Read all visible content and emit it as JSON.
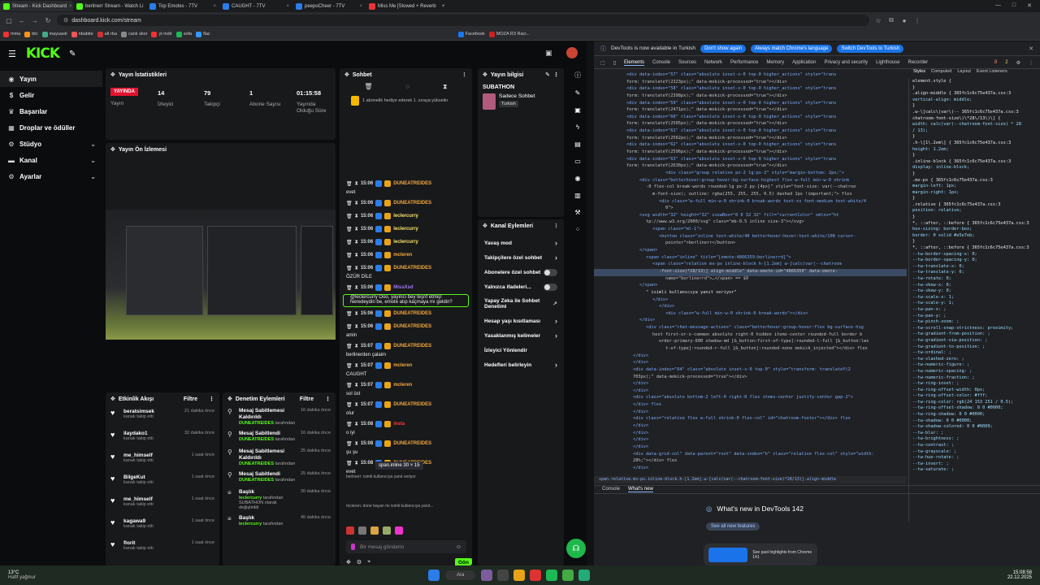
{
  "browser": {
    "tabs": [
      {
        "label": "Stream - Kick Dashboard",
        "color": "#53fc18"
      },
      {
        "label": "berlinerr Stream - Watch Li",
        "color": "#53fc18"
      },
      {
        "label": "Top Emotes - 7TV",
        "color": "#2b7de9"
      },
      {
        "label": "CAUGHT - 7TV",
        "color": "#2b7de9"
      },
      {
        "label": "peepoCheer - 7TV",
        "color": "#2b7de9"
      },
      {
        "label": "Miss Me [Slowed + Reverb",
        "color": "#e33"
      }
    ],
    "url": "dashboard.kick.com/stream",
    "bookmarks": [
      "mma",
      "btc",
      "mayuasti",
      "nbabite",
      "alt rba",
      "canlı skor",
      "yt indir",
      "sofa",
      "flac",
      "Facebook",
      "MOZA R3 Raci..."
    ]
  },
  "kick": {
    "logo": "KICK",
    "nav": [
      {
        "label": "Yayın",
        "icon": "broadcast-icon",
        "chev": false
      },
      {
        "label": "Gelir",
        "icon": "money-icon",
        "chev": false
      },
      {
        "label": "Başarılar",
        "icon": "trophy-icon",
        "chev": false
      },
      {
        "label": "Droplar ve ödüller",
        "icon": "gift-icon",
        "chev": false
      },
      {
        "label": "Stüdyo",
        "icon": "studio-icon",
        "chev": true
      },
      {
        "label": "Kanal",
        "icon": "user-icon",
        "chev": true
      },
      {
        "label": "Ayarlar",
        "icon": "settings-icon",
        "chev": true
      }
    ],
    "stats": {
      "title": "Yayın İstatistikleri",
      "live": "YAYINDA",
      "live_label": "Yayın",
      "viewers": "14",
      "viewers_label": "İzleyici",
      "followers": "79",
      "followers_label": "Takipçi",
      "subs": "1",
      "subs_label": "Abone Sayısı",
      "uptime": "01:15:58",
      "uptime_label": "Yayında Olduğu Süre"
    },
    "preview_title": "Yayın Ön İzlemesi",
    "activity": {
      "title": "Etkinlik Akışı",
      "filter": "Filtre",
      "items": [
        {
          "name": "beratsimsek",
          "sub": "kanalı takip etti",
          "time": "21 dakika önce"
        },
        {
          "name": "ilaydako1",
          "sub": "kanalı takip etti",
          "time": "32 dakika önce"
        },
        {
          "name": "me_himself",
          "sub": "kanalı takip etti",
          "time": "1 saat önce"
        },
        {
          "name": "BilgeKut",
          "sub": "kanalı takip etti",
          "time": "1 saat önce"
        },
        {
          "name": "me_himself",
          "sub": "kanalı takip etti",
          "time": "1 saat önce"
        },
        {
          "name": "kagawa9",
          "sub": "kanalı takip etti",
          "time": "1 saat önce"
        },
        {
          "name": "florit",
          "sub": "kanalı takip etti",
          "time": "1 saat önce"
        }
      ]
    },
    "moderation": {
      "title": "Denetim Eylemleri",
      "filter": "Filtre",
      "items": [
        {
          "title": "Mesaj Sabitlemesi Kaldırıldı",
          "by": "DUNEATREIDES",
          "suffix": "tarafından",
          "time": "16 dakika önce"
        },
        {
          "title": "Mesaj Sabitlendi",
          "by": "DUNEATREIDES",
          "suffix": "tarafından",
          "time": "16 dakika önce"
        },
        {
          "title": "Mesaj Sabitlemesi Kaldırıldı",
          "by": "DUNEATREIDES",
          "suffix": "tarafından",
          "time": "25 dakika önce"
        },
        {
          "title": "Mesaj Sabitlendi",
          "by": "DUNEATREIDES",
          "suffix": "tarafından",
          "time": "25 dakika önce"
        },
        {
          "title": "Başlık",
          "by": "leclercurry",
          "suffix": "tarafından SUBATHON olarak değiştirildi",
          "time": "30 dakika önce"
        },
        {
          "title": "Başlık",
          "by": "leclercurry",
          "suffix": "tarafından",
          "time": "45 dakika önce"
        }
      ]
    },
    "chat": {
      "title": "Sohbet",
      "gift_text": "1 abonelik hediye ederek 1. sıraya yükselin",
      "messages": [
        {
          "time": "15:06",
          "user": "DUNEATREIDES",
          "cls": "u1",
          "text": "evet"
        },
        {
          "time": "15:06",
          "user": "DUNEATREIDES",
          "cls": "u1",
          "text": ""
        },
        {
          "time": "15:06",
          "user": "leclercurry",
          "cls": "u4",
          "text": ""
        },
        {
          "time": "15:06",
          "user": "leclercurry",
          "cls": "u4",
          "text": ""
        },
        {
          "time": "15:06",
          "user": "leclercurry",
          "cls": "u4",
          "text": ""
        },
        {
          "time": "15:06",
          "user": "mcleren",
          "cls": "u1",
          "text": ""
        },
        {
          "time": "15:06",
          "user": "DUNEATREIDES",
          "cls": "u1",
          "text": "ÖZÜR DİLE"
        },
        {
          "time": "15:06",
          "user": "MissXsd",
          "cls": "u5",
          "text": "@leclercurry Ooo, yayıncı bey teşrif etmiş! Neredeydin be, emote atıp kaçmaya mı geldin?"
        },
        {
          "time": "15:06",
          "user": "DUNEATREIDES",
          "cls": "u1",
          "text": ""
        },
        {
          "time": "15:06",
          "user": "DUNEATREIDES",
          "cls": "u1",
          "text": "amin"
        },
        {
          "time": "15:07",
          "user": "DUNEATREIDES",
          "cls": "u1",
          "text": "berlinerden çalaim"
        },
        {
          "time": "15:07",
          "user": "mcleren",
          "cls": "u1",
          "text": "CAUGHT"
        },
        {
          "time": "15:07",
          "user": "mcleren",
          "cls": "u1",
          "text": "sol üst"
        },
        {
          "time": "15:07",
          "user": "DUNEATREIDES",
          "cls": "u1",
          "text": "olur"
        },
        {
          "time": "15:08",
          "user": "insta",
          "cls": "u3",
          "text": "o iyi"
        },
        {
          "time": "15:08",
          "user": "DUNEATREIDES",
          "cls": "u1",
          "text": "şu şu"
        },
        {
          "time": "15:08",
          "user": "DUNEATREIDES",
          "cls": "u1",
          "text": "evet"
        }
      ],
      "tooltip": "span.inline 30 × 15",
      "reply1": "berlinerr: isimli kullanıcıya yanıt veriyor",
      "reply2": "mcleren: done bayan mı isimli kullanıcıya yanıt...",
      "placeholder": "Bir mesaj gönderin",
      "send": "Gön"
    },
    "info": {
      "title": "Yayın bilgisi",
      "stream_title": "SUBATHON",
      "mode": "Sadece Sohbet",
      "lang": "Turkish"
    },
    "actions": {
      "title": "Kanal Eylemleri",
      "items": [
        {
          "label": "Yavaş mod",
          "kind": "chev"
        },
        {
          "label": "Takipçilere özel sohbet",
          "kind": "chev"
        },
        {
          "label": "Abonelere özel sohbet",
          "kind": "toggle"
        },
        {
          "label": "Yalnızca ifadeleri...",
          "kind": "toggle"
        },
        {
          "label": "Yapay Zeka ile Sohbet Denetimi",
          "kind": "ext"
        },
        {
          "label": "Hesap yaşı kısıtlaması",
          "kind": "chev"
        },
        {
          "label": "Yasaklanmış kelimeler",
          "kind": "chev"
        },
        {
          "label": "İzleyici Yönlendir",
          "kind": "none"
        },
        {
          "label": "Hedefleri belirleyin",
          "kind": "chev"
        }
      ]
    }
  },
  "devtools": {
    "notice": "DevTools is now available in Turkish",
    "btn1": "Don't show again",
    "btn2": "Always match Chrome's language",
    "btn3": "Switch DevTools to Turkish",
    "tabs": [
      "Elements",
      "Console",
      "Sources",
      "Network",
      "Performance",
      "Memory",
      "Application",
      "Privacy and security",
      "Lighthouse",
      "Recorder"
    ],
    "side_tabs": [
      "Styles",
      "Computed",
      "Layout",
      "Event Listeners"
    ],
    "errors": "8",
    "warnings": "2",
    "breadcrumb": "span.relative.mx-px.inline-block.h-[1.2em].w-[calc(var(--chatroom-font-size)*28/13)].align-middle",
    "drawer_tabs": [
      "Console",
      "What's new"
    ],
    "whats_new": "What's new in DevTools 142",
    "see_all": "See all new features",
    "highlights": "See past highlights from Chrome 141",
    "lines": [
      "<div data-index=\"57\" class=\"absolute inset-x-0 top-0 higher_actions\" style=\"trans",
      "form: translateY(2323px);\" data-mokick-processed=\"true\"></div>",
      "<div data-index=\"58\" class=\"absolute inset-x-0 top-0 higher_actions\" style=\"trans",
      "form: translateY(2398px);\" data-mokick-processed=\"true\"></div>",
      "<div data-index=\"59\" class=\"absolute inset-x-0 top-0 higher_actions\" style=\"trans",
      "form: translateY(2471px);\" data-mokick-processed=\"true\"></div>",
      "<div data-index=\"60\" class=\"absolute inset-x-0 top-0 higher_actions\" style=\"trans",
      "form: translateY(2505px);\" data-mokick-processed=\"true\"></div>",
      "<div data-index=\"61\" class=\"absolute inset-x-0 top-0 higher_actions\" style=\"trans",
      "form: translateY(2562px);\" data-mokick-processed=\"true\"></div>",
      "<div data-index=\"62\" class=\"absolute inset-x-0 top-0 higher_actions\" style=\"trans",
      "form: translateY(2596px);\" data-mokick-processed=\"true\"></div>",
      "<div data-index=\"63\" class=\"absolute inset-x-0 top-0 higher_actions\" style=\"trans",
      "form: translateY(2630px);\" data-mokick-processed=\"true\"></div>",
      "<div class=\"group relative px-2 lg:px-3\" style=\"margin-bottom: 2px;\">",
      "<div class=\"betterhover:group-hover:bg-surface-highest flex w-full min-w-0 shrink",
      "-0 flex-col break-words rounded-lg px-2 py-[4px]\" style=\"font-size: var(--chatroo",
      "m-font-size); outline: rgba(255, 255, 255, 0.5) dashed 1px !important;\"> flex",
      "<div class=\"w-full min-w-0 shrink-0 break-words text-xs font-medium text-white/4",
      "0\">",
      "<svg width=\"32\" height=\"32\" viewBox=\"0 0 32 32\" fill=\"currentColor\" xmlns=\"ht",
      "tp://www.w3.org/2000/svg\" class=\"mb-0.5 inline size-3\"></svg>",
      "<span class=\"ml-1\">",
      "<button class=\"inline text-white/40 betterhover:hover:text-white/100 cursor-",
      "pointer\">berlinerr</button>",
      "</span>",
      "<span class=\"inline\" title=\"[emote:4866359:berlinerrd]\">",
      "<span class=\"relative mx-px inline-block h-[1.2em] w-[calc(var(--chatroom",
      "-font-size)*28/13)] align-middle\" data-emote-id=\"4866359\" data-emote-",
      "name=\"berlinerrd\">…</span> == $0",
      "</span>",
      "\" isimli kullanıcıya yanıt veriyor\"",
      "</div>",
      "</div>",
      "<div class=\"w-full min-w-0 shrink-0 break-words\"></div>",
      "</div>",
      "<div class=\"chat-message-actions\" class=\"betterhover:group-hover:flex bg-surface-hig",
      "hest first-or-x-common absolute right-0 hidden items-center rounded-full border b",
      "order-primary-600 shadow-md [&_button:first-of-type]:rounded-l-full [&_button:las",
      "t-of-type]:rounded-r-full [&_button]:rounded-none mokick_injected\"></div> flex",
      "</div>",
      "</div>",
      "<div data-index=\"64\" class=\"absolute inset-x-0 top-0\" style=\"transform: translateY(2",
      "703px);\" data-mokick-processed=\"true\"></div>",
      "</div>",
      "</div>",
      "<div class=\"absolute bottom-2 left-0 right-0 flex items-center justify-center gap-2\">",
      "</div>  flex",
      "</div>",
      "<div class=\"relative flex w-full shrink-0 flex-col\" id=\"chatroom-footer\"></div> flex",
      "</div>",
      "</div>",
      "</div>",
      "</div>",
      "<div data-grid-col\" data-parent=\"root\" data-index=\"h\" class=\"relative flex-col\" style=\"width:",
      "28%;\"></div>  flex",
      "</div>"
    ],
    "styles": [
      "element.style {",
      "}",
      ".align-middle {        365fc1c6c75e437a.css:3",
      "  vertical-align: middle;",
      "}",
      ".w-\\[calc\\(var\\(--  365fc1c6c75e437a.css:3",
      "chatroom-font-size\\)\\*28\\/13\\)\\] {",
      "  width: calc(var(--chatroom-font-size) * 28",
      "  / 13);",
      "}",
      ".h-\\[1\\.2em\\] {       365fc1c6c75e437a.css:3",
      "  height: 1.2em;",
      "}",
      ".inline-block {        365fc1c6c75e437a.css:3",
      "  display: inline-block;",
      "}",
      ".mx-px {               365fc1c6c75e437a.css:3",
      "  margin-left: 1px;",
      "  margin-right: 1px;",
      "}",
      ".relative {            365fc1c6c75e437a.css:3",
      "  position: relative;",
      "}",
      "*, ::after, ::before { 365fc1c6c75e437a.css:3",
      "  box-sizing: border-box;",
      "  border: 0 solid #e5e7eb;",
      "}",
      "*, ::after, ::before { 365fc1c6c75e437a.css:3",
      "  --tw-border-spacing-x: 0;",
      "  --tw-border-spacing-y: 0;",
      "  --tw-translate-x: 0;",
      "  --tw-translate-y: 0;",
      "  --tw-rotate: 0;",
      "  --tw-skew-x: 0;",
      "  --tw-skew-y: 0;",
      "  --tw-scale-x: 1;",
      "  --tw-scale-y: 1;",
      "  --tw-pan-x: ;",
      "  --tw-pan-y: ;",
      "  --tw-pinch-zoom: ;",
      "  --tw-scroll-snap-strictness: proximity;",
      "  --tw-gradient-from-position: ;",
      "  --tw-gradient-via-position: ;",
      "  --tw-gradient-to-position: ;",
      "  --tw-ordinal: ;",
      "  --tw-slashed-zero: ;",
      "  --tw-numeric-figure: ;",
      "  --tw-numeric-spacing: ;",
      "  --tw-numeric-fraction: ;",
      "  --tw-ring-inset: ;",
      "  --tw-ring-offset-width: 0px;",
      "  --tw-ring-offset-color: #fff;",
      "  --tw-ring-color: rgb(24 153 251 / 0.5);",
      "  --tw-ring-offset-shadow: 0 0 #0000;",
      "  --tw-ring-shadow: 0 0 #0000;",
      "  --tw-shadow: 0 0 #0000;",
      "  --tw-shadow-colored: 0 0 #0000;",
      "  --tw-blur: ;",
      "  --tw-brightness: ;",
      "  --tw-contrast: ;",
      "  --tw-grayscale: ;",
      "  --tw-hue-rotate: ;",
      "  --tw-invert: ;",
      "  --tw-saturate: ;"
    ]
  },
  "taskbar": {
    "weather": "13°C",
    "weather_sub": "Hafif yağmur",
    "search": "Ara",
    "time": "15:08:58",
    "date": "22.12.2025"
  }
}
